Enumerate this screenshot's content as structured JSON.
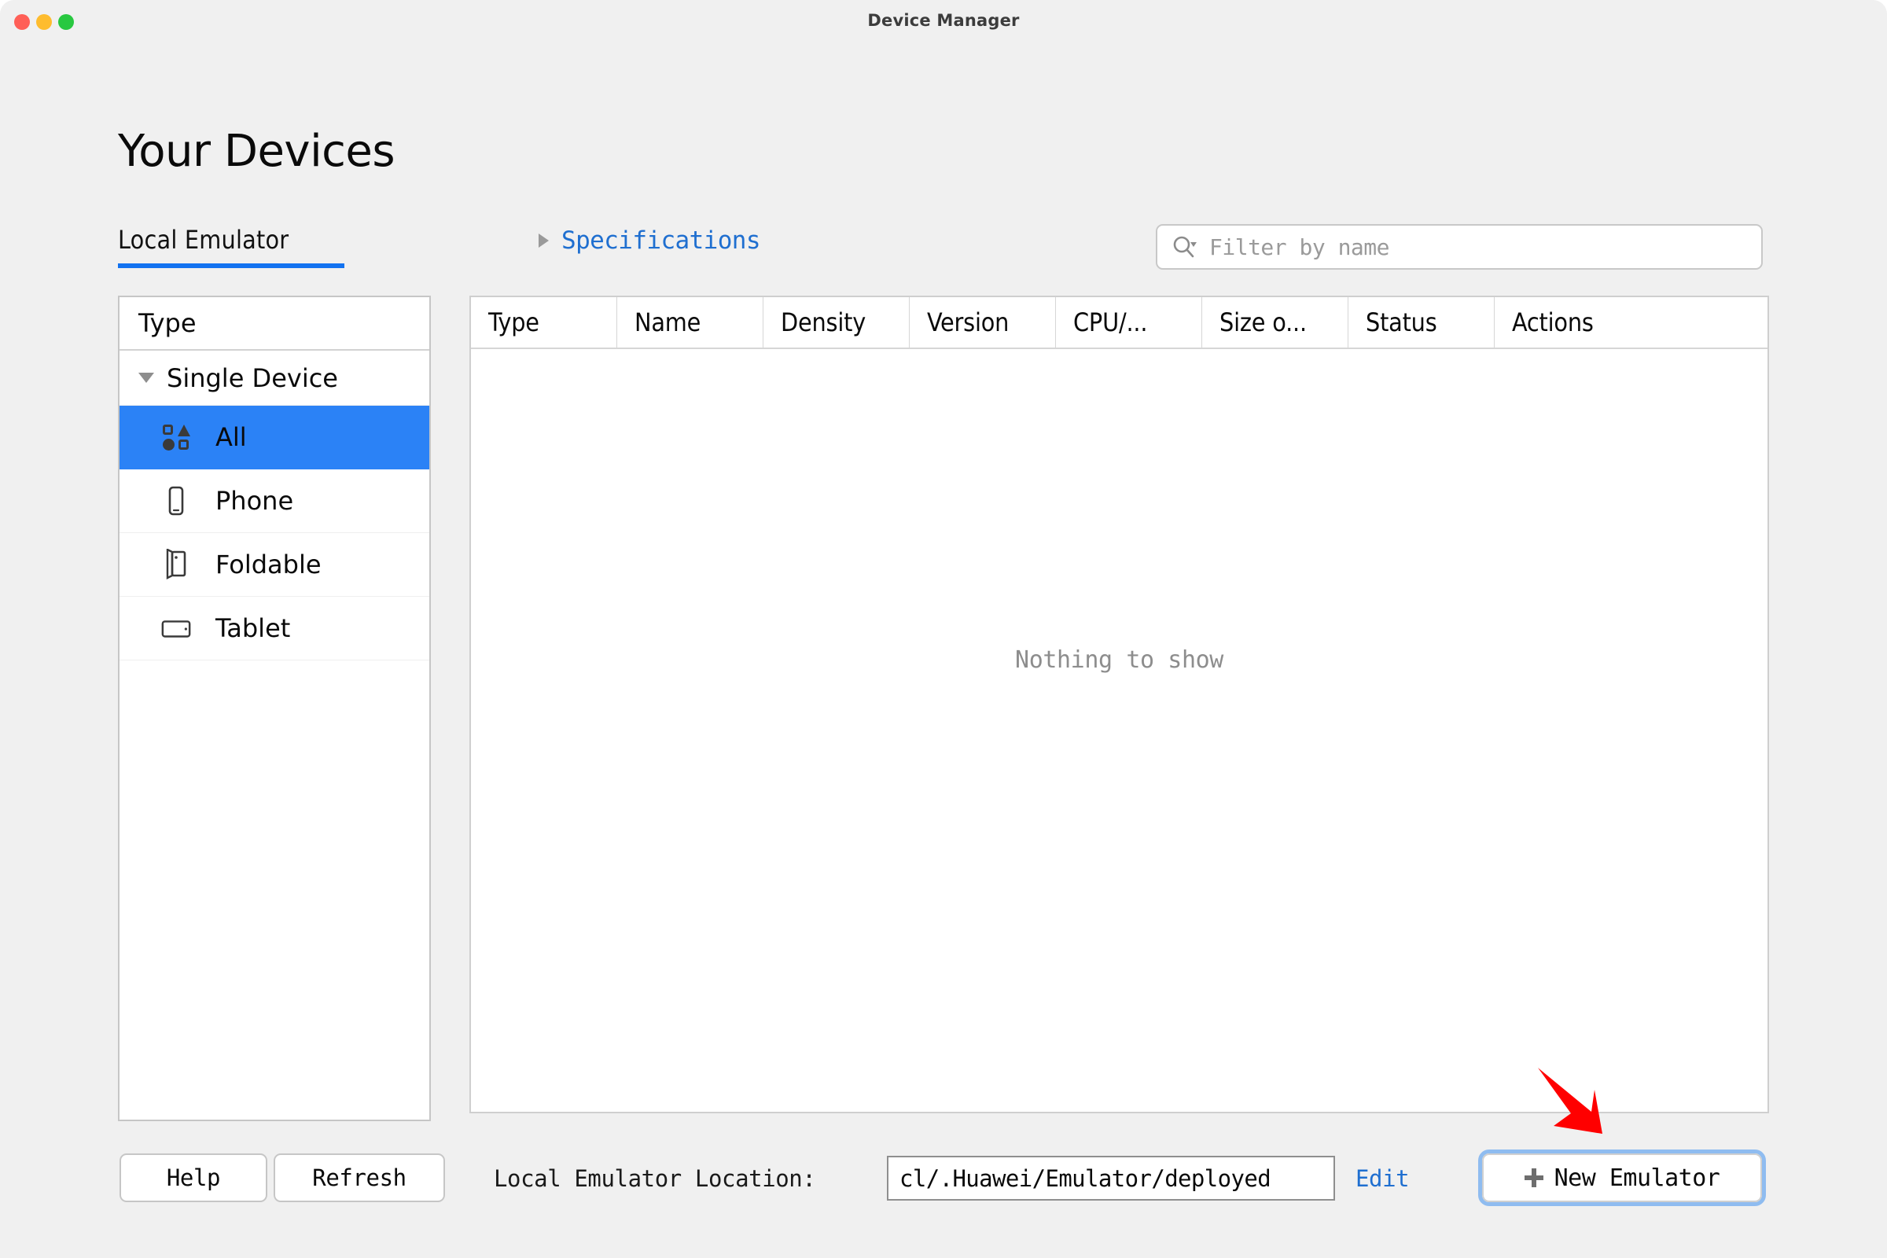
{
  "window": {
    "title": "Device Manager",
    "controls": [
      "close-button",
      "minimize-button",
      "zoom-button"
    ]
  },
  "page": {
    "heading": "Your Devices"
  },
  "tabs": {
    "active": "Local Emulator",
    "items": [
      "Local Emulator"
    ]
  },
  "specifications": {
    "label": "Specifications",
    "expanded": false,
    "color": "#1f6fd0"
  },
  "search": {
    "icon": "search-icon",
    "placeholder": "Filter by name",
    "value": ""
  },
  "type_panel": {
    "header": "Type",
    "group": {
      "label": "Single Device",
      "expanded": true
    },
    "items": [
      {
        "label": "All",
        "icon": "shapes-grid-icon",
        "selected": true
      },
      {
        "label": "Phone",
        "icon": "phone-icon",
        "selected": false
      },
      {
        "label": "Foldable",
        "icon": "foldable-icon",
        "selected": false
      },
      {
        "label": "Tablet",
        "icon": "tablet-icon",
        "selected": false
      }
    ],
    "selected_color": "#2b82f6"
  },
  "device_table": {
    "columns": [
      {
        "label": "Type",
        "width": 186
      },
      {
        "label": "Name",
        "width": 186
      },
      {
        "label": "Density",
        "width": 186
      },
      {
        "label": "Version",
        "width": 186
      },
      {
        "label": "CPU/...",
        "width": 186
      },
      {
        "label": "Size o...",
        "width": 186
      },
      {
        "label": "Status",
        "width": 186
      },
      {
        "label": "Actions",
        "width": 186
      }
    ],
    "rows": [],
    "empty_message": "Nothing to show"
  },
  "footer": {
    "help_label": "Help",
    "refresh_label": "Refresh",
    "location_label": "Local Emulator Location:",
    "location_value": "cl/.Huawei/Emulator/deployed",
    "edit_label": "Edit",
    "new_emulator_label": "New Emulator",
    "new_emulator_icon": "plus-icon",
    "new_emulator_focused": true
  },
  "annotation": {
    "type": "arrow",
    "color": "#ff0000",
    "points_to": "new-emulator-button"
  }
}
